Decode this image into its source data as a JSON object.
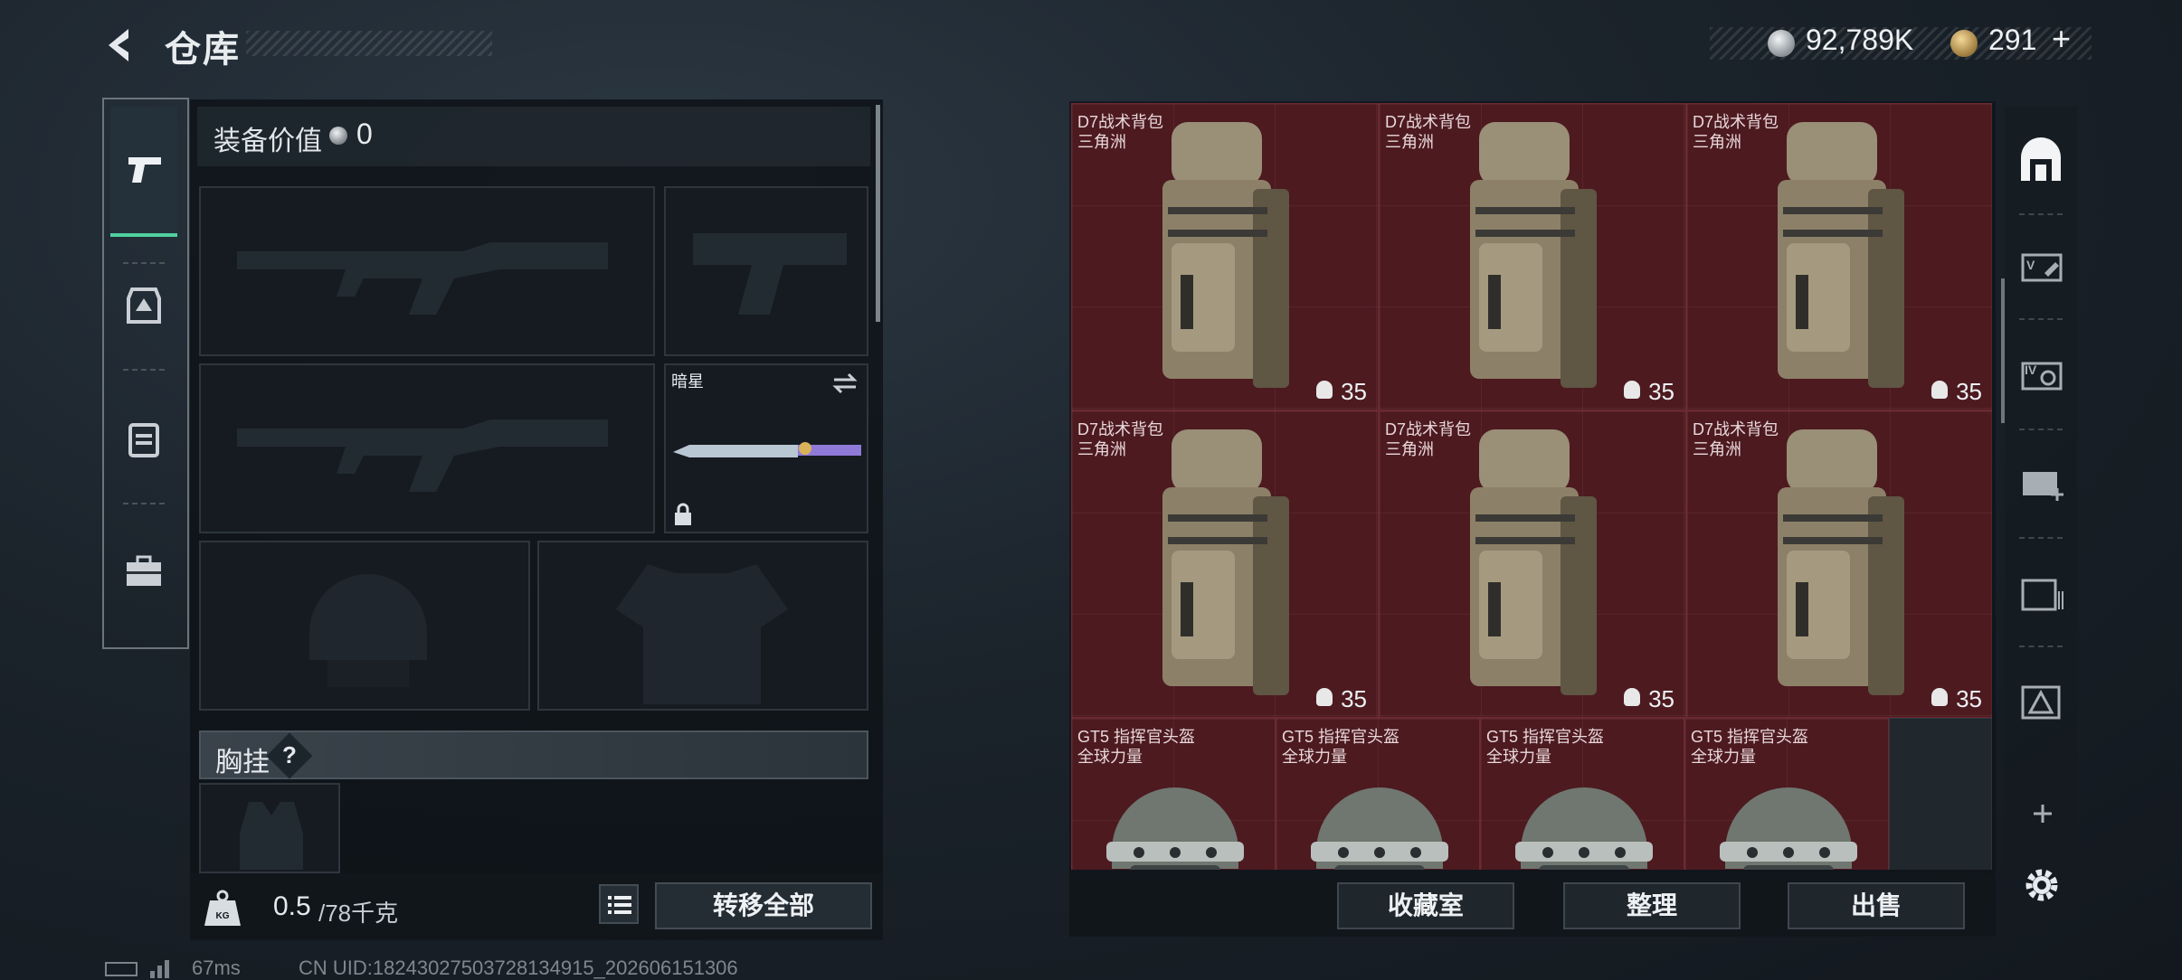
{
  "header": {
    "title": "仓库",
    "currency": [
      {
        "value": "92,789K",
        "icon": "silver-coin-icon"
      },
      {
        "value": "291",
        "icon": "gold-coin-icon",
        "suffix": "+"
      }
    ]
  },
  "left_tabs": [
    {
      "name": "weapons",
      "icon": "pistol-icon",
      "active": true
    },
    {
      "name": "armor",
      "icon": "vest-icon"
    },
    {
      "name": "backpack",
      "icon": "backpack-icon"
    },
    {
      "name": "toolbox",
      "icon": "toolbox-icon"
    }
  ],
  "loadout": {
    "equip_value_label": "装备价值",
    "equip_value": "0",
    "melee_name": "暗星",
    "chest_rig_label": "胸挂",
    "help": "?"
  },
  "bottom_left": {
    "weight_value": "0.5",
    "weight_total": "/78千克",
    "transfer_all": "转移全部"
  },
  "status": {
    "ping": "67ms",
    "uid": "CN UID:18243027503728134915_202606151306"
  },
  "storage": {
    "items": [
      {
        "name": "D7战术背包",
        "sub": "三角洲",
        "capacity": "35"
      },
      {
        "name": "D7战术背包",
        "sub": "三角洲",
        "capacity": "35"
      },
      {
        "name": "D7战术背包",
        "sub": "三角洲",
        "capacity": "35"
      },
      {
        "name": "D7战术背包",
        "sub": "三角洲",
        "capacity": "35"
      },
      {
        "name": "D7战术背包",
        "sub": "三角洲",
        "capacity": "35"
      },
      {
        "name": "D7战术背包",
        "sub": "三角洲",
        "capacity": "35"
      },
      {
        "name": "GT5 指挥官头盔",
        "sub": "全球力量"
      },
      {
        "name": "GT5 指挥官头盔",
        "sub": "全球力量"
      },
      {
        "name": "GT5 指挥官头盔",
        "sub": "全球力量"
      },
      {
        "name": "GT5 指挥官头盔",
        "sub": "全球力量"
      }
    ],
    "buttons": {
      "collection": "收藏室",
      "sort": "整理",
      "sell": "出售"
    }
  },
  "right_sidebar": [
    "warehouse-icon",
    "storage-v-icon",
    "storage-iv-icon",
    "add-storage-icon",
    "storage-iii-icon",
    "storage-ii-icon",
    "plus-icon",
    "gear-icon"
  ],
  "colors": {
    "accent": "#4fd1a0",
    "item_bg": "#4d1a20"
  }
}
